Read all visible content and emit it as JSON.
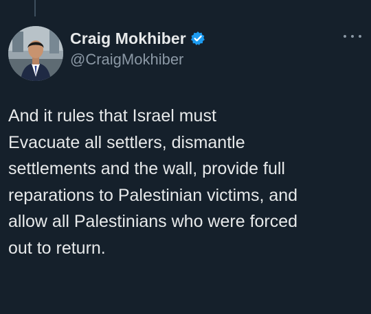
{
  "tweet": {
    "author": {
      "display_name": "Craig Mokhiber",
      "handle": "@CraigMokhiber",
      "verified": true,
      "avatar_icon": "profile-photo-man-in-suit"
    },
    "text": "And it rules that Israel must\nEvacuate all settlers, dismantle\nsettlements and the wall, provide full\nreparations to Palestinian victims, and\nallow all Palestinians who were forced\nout to return.",
    "more_icon": "more-horizontal-icon"
  },
  "colors": {
    "background": "#15202b",
    "text_primary": "#e7e9ea",
    "text_secondary": "#8b98a5",
    "verified_badge": "#1d9bf0"
  }
}
